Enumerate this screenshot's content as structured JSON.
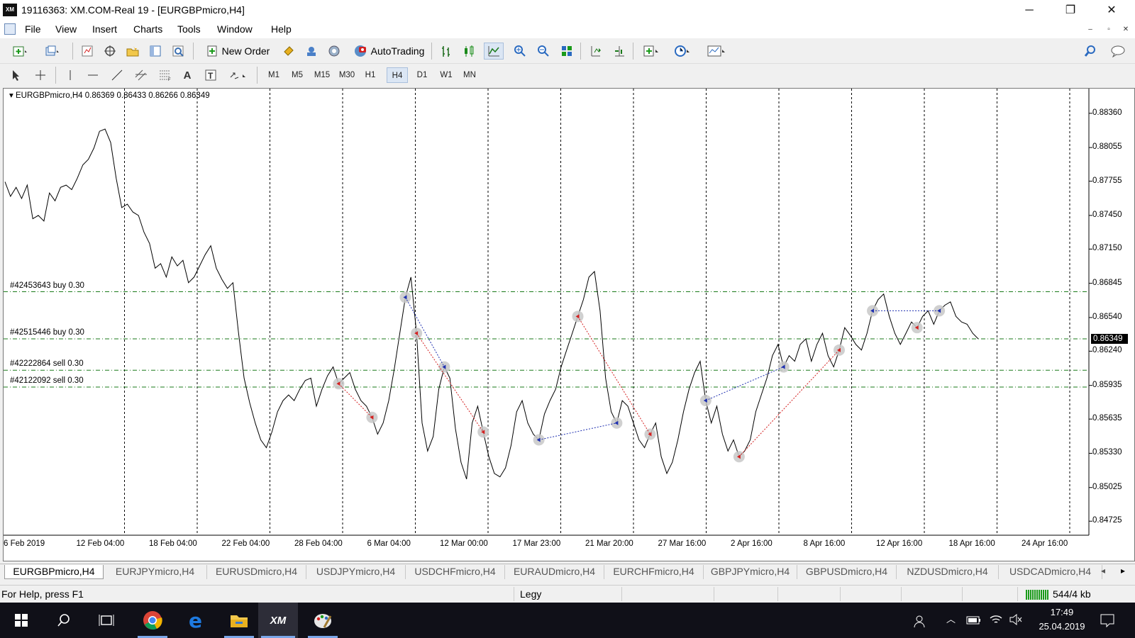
{
  "window": {
    "title": "19116363: XM.COM-Real 19 - [EURGBPmicro,H4]",
    "logo_text": "XM",
    "minimize": "─",
    "maximize": "❐",
    "close": "✕"
  },
  "menu": [
    "File",
    "View",
    "Insert",
    "Charts",
    "Tools",
    "Window",
    "Help"
  ],
  "toolbar": {
    "new_order": "New Order",
    "autotrading": "AutoTrading"
  },
  "timeframes": [
    "M1",
    "M5",
    "M15",
    "M30",
    "H1",
    "H4",
    "D1",
    "W1",
    "MN"
  ],
  "active_timeframe": "H4",
  "chart": {
    "info": "EURGBPmicro,H4  0.86369 0.86433 0.86266 0.86349",
    "current_price": "0.86349",
    "orders": [
      {
        "label": "#42453643 buy 0.30",
        "price": 0.8677
      },
      {
        "label": "#42515446 buy 0.30",
        "price": 0.8635
      },
      {
        "label": "#42222864 sell 0.30",
        "price": 0.8607
      },
      {
        "label": "#42122092 sell 0.30",
        "price": 0.8592
      }
    ],
    "colors": {
      "grid": "#000000",
      "order_line": "#1a7a1a",
      "buy": "#1e2fb0",
      "sell": "#d42020",
      "price": "#000000"
    }
  },
  "chart_data": {
    "type": "line",
    "title": "EURGBPmicro,H4",
    "y_tick_labels": [
      "0.88360",
      "0.88055",
      "0.87755",
      "0.87450",
      "0.87150",
      "0.86845",
      "0.86540",
      "0.86240",
      "0.85935",
      "0.85635",
      "0.85330",
      "0.85025",
      "0.84725"
    ],
    "y_ticks": [
      0.8836,
      0.88055,
      0.87755,
      0.8745,
      0.8715,
      0.86845,
      0.8654,
      0.8624,
      0.85935,
      0.85635,
      0.8533,
      0.85025,
      0.84725
    ],
    "ylim": [
      0.846,
      0.8858
    ],
    "x_labels": [
      "6 Feb 2019",
      "12 Feb 04:00",
      "18 Feb 04:00",
      "22 Feb 04:00",
      "28 Feb 04:00",
      "6 Mar 04:00",
      "12 Mar 00:00",
      "17 Mar 23:00",
      "21 Mar 20:00",
      "27 Mar 16:00",
      "2 Apr 16:00",
      "8 Apr 16:00",
      "12 Apr 16:00",
      "18 Apr 16:00",
      "24 Apr 16:00"
    ],
    "grid": "vertical dotted",
    "close_prices": [
      0.8775,
      0.8762,
      0.877,
      0.876,
      0.8772,
      0.8742,
      0.8745,
      0.874,
      0.8765,
      0.8758,
      0.877,
      0.8772,
      0.8768,
      0.8778,
      0.879,
      0.8795,
      0.8805,
      0.882,
      0.8822,
      0.881,
      0.8778,
      0.8752,
      0.8755,
      0.8748,
      0.8745,
      0.873,
      0.872,
      0.8698,
      0.8702,
      0.869,
      0.8708,
      0.87,
      0.8705,
      0.8685,
      0.869,
      0.87,
      0.871,
      0.8718,
      0.8698,
      0.8688,
      0.868,
      0.8685,
      0.864,
      0.86,
      0.8578,
      0.856,
      0.8545,
      0.8538,
      0.8552,
      0.857,
      0.858,
      0.8585,
      0.858,
      0.859,
      0.8598,
      0.86,
      0.8575,
      0.859,
      0.8602,
      0.861,
      0.8595,
      0.86,
      0.8605,
      0.859,
      0.858,
      0.8575,
      0.8565,
      0.855,
      0.856,
      0.858,
      0.8608,
      0.864,
      0.8672,
      0.869,
      0.864,
      0.856,
      0.8535,
      0.8548,
      0.859,
      0.861,
      0.86,
      0.8555,
      0.8525,
      0.851,
      0.856,
      0.8575,
      0.8552,
      0.853,
      0.8515,
      0.8512,
      0.852,
      0.854,
      0.857,
      0.858,
      0.856,
      0.855,
      0.8545,
      0.8568,
      0.858,
      0.859,
      0.861,
      0.8625,
      0.864,
      0.8655,
      0.867,
      0.869,
      0.8695,
      0.866,
      0.86,
      0.857,
      0.856,
      0.858,
      0.8575,
      0.856,
      0.8545,
      0.8538,
      0.855,
      0.856,
      0.853,
      0.8515,
      0.8525,
      0.8545,
      0.857,
      0.859,
      0.8605,
      0.8615,
      0.858,
      0.856,
      0.8575,
      0.855,
      0.8535,
      0.8545,
      0.853,
      0.8535,
      0.8545,
      0.857,
      0.8585,
      0.86,
      0.862,
      0.863,
      0.861,
      0.862,
      0.8615,
      0.863,
      0.8635,
      0.8615,
      0.863,
      0.864,
      0.862,
      0.861,
      0.8625,
      0.8645,
      0.8638,
      0.863,
      0.8625,
      0.864,
      0.866,
      0.867,
      0.8675,
      0.8655,
      0.864,
      0.863,
      0.864,
      0.865,
      0.8645,
      0.8655,
      0.866,
      0.8648,
      0.866,
      0.8665,
      0.8668,
      0.8655,
      0.865,
      0.8648,
      0.864,
      0.8635
    ]
  },
  "tabs": [
    "EURGBPmicro,H4",
    "EURJPYmicro,H4",
    "EURUSDmicro,H4",
    "USDJPYmicro,H4",
    "USDCHFmicro,H4",
    "EURAUDmicro,H4",
    "EURCHFmicro,H4",
    "GBPJPYmicro,H4",
    "GBPUSDmicro,H4",
    "NZDUSDmicro,H4",
    "USDCADmicro,H4"
  ],
  "tab_scroll_left": "◂",
  "tab_scroll_right": "▸",
  "status": {
    "help": "For Help, press F1",
    "profile": "Legy",
    "traffic": "544/4 kb"
  },
  "taskbar": {
    "time": "17:49",
    "date": "25.04.2019",
    "apps": [
      "start-icon",
      "search-icon",
      "task-view-icon",
      "chrome-icon",
      "edge-icon",
      "file-explorer-icon",
      "xm-terminal-icon",
      "paint-icon"
    ],
    "xm_label": "XM"
  }
}
